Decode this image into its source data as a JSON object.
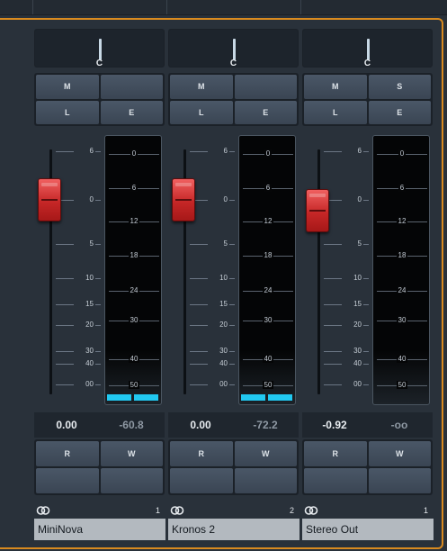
{
  "colors": {
    "accent": "#d98a1f",
    "meter": "#21c8f0",
    "fader": "#d83434"
  },
  "strips": [
    {
      "pan": "C",
      "buttons": [
        "M",
        "",
        "L",
        "E"
      ],
      "fader_db": "0.00",
      "peak_db": "-60.8",
      "rw": [
        "R",
        "W",
        "",
        ""
      ],
      "route": "1",
      "name": "MiniNova",
      "level_fraction": 0.8,
      "meter_fraction": 0.03
    },
    {
      "pan": "C",
      "buttons": [
        "M",
        "",
        "L",
        "E"
      ],
      "fader_db": "0.00",
      "peak_db": "-72.2",
      "rw": [
        "R",
        "W",
        "",
        ""
      ],
      "route": "2",
      "name": "Kronos 2",
      "level_fraction": 0.8,
      "meter_fraction": 0.03
    },
    {
      "pan": "C",
      "buttons": [
        "M",
        "S",
        "L",
        "E"
      ],
      "fader_db": "-0.92",
      "peak_db": "-oo",
      "rw": [
        "R",
        "W",
        "",
        ""
      ],
      "route": "1",
      "name": "Stereo Out",
      "level_fraction": 0.76,
      "meter_fraction": 0
    }
  ],
  "fader_scale": [
    "6",
    "0",
    "5",
    "10",
    "15",
    "20",
    "30",
    "40",
    "00"
  ],
  "meter_scale": [
    "0",
    "6",
    "12",
    "18",
    "24",
    "30",
    "40",
    "50"
  ]
}
